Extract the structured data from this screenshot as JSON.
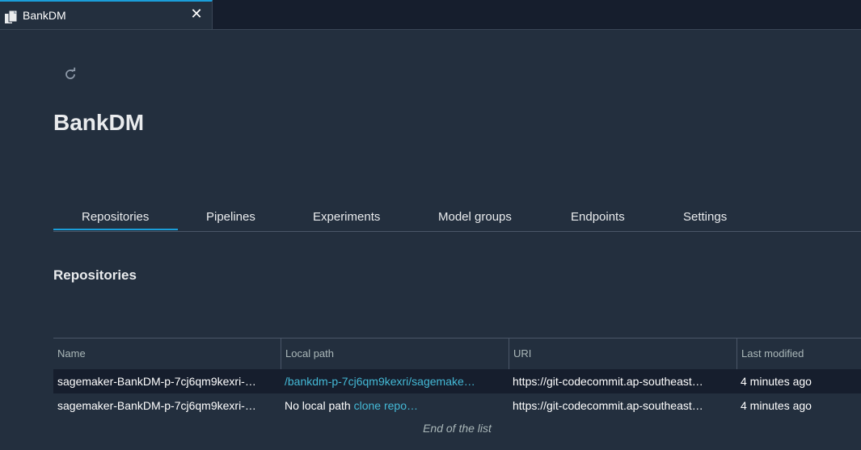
{
  "tab": {
    "title": "BankDM",
    "close": "✕"
  },
  "page": {
    "title": "BankDM"
  },
  "nav_tabs": [
    "Repositories",
    "Pipelines",
    "Experiments",
    "Model groups",
    "Endpoints",
    "Settings"
  ],
  "section": {
    "title": "Repositories"
  },
  "table": {
    "columns": [
      "Name",
      "Local path",
      "URI",
      "Last modified"
    ],
    "rows": [
      {
        "name": "sagemaker-BankDM-p-7cj6qm9kexri-…",
        "local_path": "/bankdm-p-7cj6qm9kexri/sagemake…",
        "local_path_is_link": true,
        "uri": "https://git-codecommit.ap-southeast…",
        "last_modified": "4 minutes ago"
      },
      {
        "name": "sagemaker-BankDM-p-7cj6qm9kexri-…",
        "local_path": "No local path",
        "clone_link": "clone repo…",
        "uri": "https://git-codecommit.ap-southeast…",
        "last_modified": "4 minutes ago"
      }
    ],
    "end_text": "End of the list"
  },
  "colors": {
    "accent": "#1a9ed9",
    "link": "#44b9d6",
    "background": "#232f3e"
  }
}
